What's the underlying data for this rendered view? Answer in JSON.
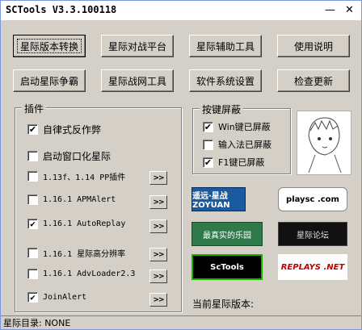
{
  "window": {
    "title": "SCTools V3.3.100118",
    "minimize_glyph": "—",
    "close_glyph": "✕"
  },
  "toolbar": {
    "row1": [
      "星际版本转换",
      "星际对战平台",
      "星际辅助工具",
      "使用说明"
    ],
    "row2": [
      "启动星际争霸",
      "星际战网工具",
      "软件系统设置",
      "检查更新"
    ]
  },
  "plugins": {
    "label": "插件",
    "items": [
      {
        "label": "自律式反作弊",
        "checked": true,
        "has_more": false
      },
      {
        "label": "启动窗口化星际",
        "checked": false,
        "has_more": false
      },
      {
        "label": "1.13f、1.14 PP插件",
        "checked": false,
        "has_more": true
      },
      {
        "label": "1.16.1 APMAlert",
        "checked": false,
        "has_more": true
      },
      {
        "label": "1.16.1 AutoReplay",
        "checked": true,
        "has_more": true
      },
      {
        "label": "1.16.1 星际高分辨率",
        "checked": false,
        "has_more": true
      },
      {
        "label": "1.16.1 AdvLoader2.3",
        "checked": false,
        "has_more": true
      },
      {
        "label": "JoinAlert",
        "checked": true,
        "has_more": true
      }
    ],
    "more_label": ">>"
  },
  "hotkeys": {
    "label": "按键屏蔽",
    "items": [
      {
        "label": "Win键已屏蔽",
        "checked": true
      },
      {
        "label": "输入法已屏蔽",
        "checked": false
      },
      {
        "label": "F1键已屏蔽",
        "checked": true
      }
    ]
  },
  "banners": [
    {
      "name": "zoyuan-banner",
      "text": "遥远·星战 ZOYUAN",
      "bg": "#1a5aa0",
      "fg": "#ffffff"
    },
    {
      "name": "playsc-banner",
      "text": "playsc .com",
      "bg": "#ffffff",
      "fg": "#000000"
    },
    {
      "name": "realworld-banner",
      "text": "最真实的乐园",
      "bg": "#2f7a4a",
      "fg": "#ffffff"
    },
    {
      "name": "forum-banner",
      "text": "星际论坛",
      "bg": "#111111",
      "fg": "#e0e0e0"
    },
    {
      "name": "sctools-banner",
      "text": "ScTools",
      "bg": "#000000",
      "fg": "#ffffff"
    },
    {
      "name": "replays-banner",
      "text": "REPLAYS .NET",
      "bg": "#ffffff",
      "fg": "#c00000"
    }
  ],
  "current_version_label": "当前星际版本:",
  "status": {
    "text": "星际目录: NONE"
  }
}
